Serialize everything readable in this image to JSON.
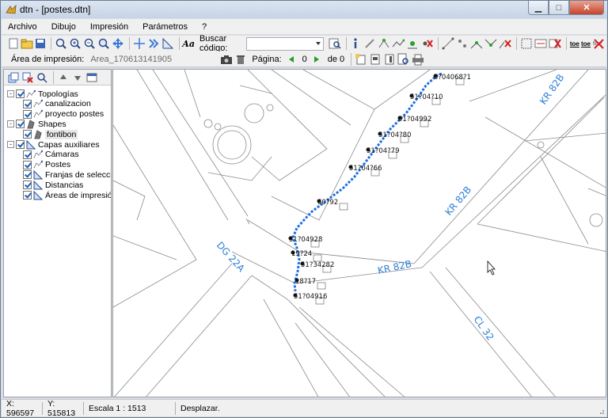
{
  "window": {
    "title": "dtn - [postes.dtn]"
  },
  "menu": [
    "Archivo",
    "Dibujo",
    "Impresión",
    "Parámetros",
    "?"
  ],
  "toolbar": {
    "search_label": "Buscar código:",
    "print_area_label": "Área de impresión:",
    "print_area_value": "Area_170613141905",
    "page_label": "Página:",
    "page_value": "0",
    "of_label": "de 0"
  },
  "tree": [
    {
      "label": "Topologías",
      "level": 1,
      "icon": "topology-icon",
      "expand": "-"
    },
    {
      "label": "canalizacion",
      "level": 2,
      "icon": "topology-icon"
    },
    {
      "label": "proyecto postes",
      "level": 2,
      "icon": "topology-icon"
    },
    {
      "label": "Shapes",
      "level": 1,
      "icon": "shape-icon",
      "expand": "-"
    },
    {
      "label": "fontibon",
      "level": 2,
      "icon": "shape-icon"
    },
    {
      "label": "Capas auxiliares",
      "level": 1,
      "icon": "ruler-icon",
      "expand": "-"
    },
    {
      "label": "Cámaras",
      "level": 2,
      "icon": "topology-icon"
    },
    {
      "label": "Postes",
      "level": 2,
      "icon": "topology-icon"
    },
    {
      "label": "Franjas de selección",
      "level": 2,
      "icon": "ruler-icon"
    },
    {
      "label": "Distancias",
      "level": 2,
      "icon": "ruler-icon"
    },
    {
      "label": "Áreas de impresión",
      "level": 2,
      "icon": "ruler-icon"
    }
  ],
  "map": {
    "street_labels": [
      "KR 82B",
      "KR 82B",
      "DG 22A",
      "KR 82B",
      "CL 32"
    ],
    "pole_labels": [
      "5?04068?1",
      "51?04?10",
      "51?04992",
      "51?04?80",
      "51?04?79",
      "51?04?66",
      "60?92",
      "51?04928",
      "19?24",
      "51?34282",
      "18?17",
      "51?04916"
    ],
    "colors": {
      "street_label": "#2b7fd6",
      "route": "#1e6fe0",
      "lines": "#8a8a8a"
    }
  },
  "status": {
    "x": "X: 596597",
    "y": "Y: 515813",
    "scale": "Escala  1 : 1513",
    "mode": "Desplazar."
  }
}
